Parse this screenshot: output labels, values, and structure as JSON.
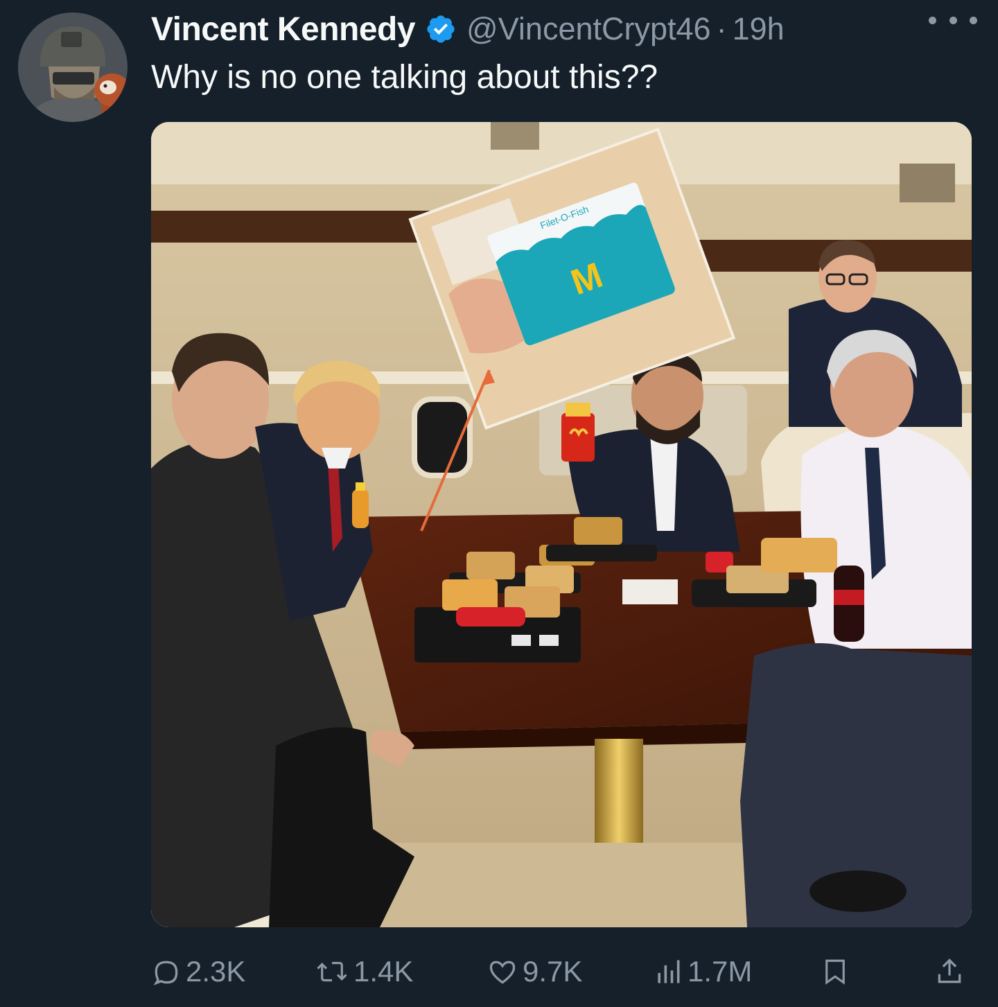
{
  "author": {
    "display_name": "Vincent Kennedy",
    "handle": "@VincentCrypt46",
    "separator": "·",
    "time": "19h",
    "verified_color": "#1d9bf0"
  },
  "tweet": {
    "text": "Why is no one talking about this??"
  },
  "media": {
    "inset_box_label": "Filet-O-Fish"
  },
  "actions": {
    "replies": "2.3K",
    "reposts": "1.4K",
    "likes": "9.7K",
    "views": "1.7M"
  },
  "icons": {
    "reply": "reply-icon",
    "repost": "repost-icon",
    "like": "heart-icon",
    "views": "views-icon",
    "bookmark": "bookmark-icon",
    "share": "share-icon",
    "more": "more-icon"
  },
  "colors": {
    "background": "#15202b",
    "text": "#f7f9f9",
    "muted": "#8b98a5",
    "accent": "#1d9bf0"
  }
}
